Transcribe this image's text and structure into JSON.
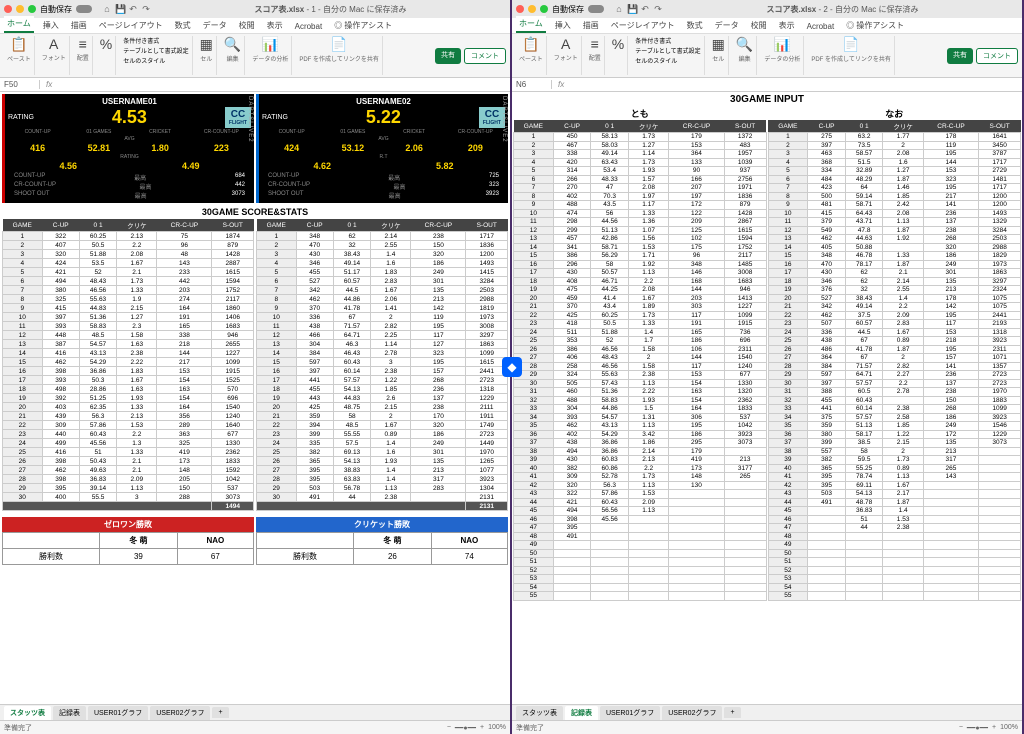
{
  "titlebar": {
    "autosave": "自動保存",
    "filename": "スコア表.xlsx",
    "win1_suffix": "- 1 - 自分の Mac に保存済み",
    "win2_suffix": "- 2 - 自分の Mac に保存済み"
  },
  "ribbon_tabs": [
    "ホーム",
    "挿入",
    "描画",
    "ページレイアウト",
    "数式",
    "データ",
    "校閲",
    "表示",
    "Acrobat",
    "◎ 操作アシスト"
  ],
  "ribbon_groups": {
    "paste": "ペースト",
    "font": "フォント",
    "align": "配置",
    "cond": "条件付き書式",
    "tblfmt": "テーブルとして書式設定",
    "cellstyle": "セルのスタイル",
    "cells": "セル",
    "edit": "編集",
    "analyze": "データの分析",
    "pdf": "PDF を作成してリンクを共有"
  },
  "share": "共有",
  "comment": "コメント",
  "cell_ref1": "F50",
  "cell_ref2": "N6",
  "fx": "fx",
  "cards": {
    "u1": {
      "name": "USERNAME01",
      "rating_lbl": "RATING",
      "rating": "4.53",
      "cc": "CC",
      "flight": "FLIGHT",
      "dl": "DARTSLIVE2",
      "hdrs": [
        "COUNT-UP",
        "01 GAMES",
        "CRICKET",
        "CR-COUNT-UP"
      ],
      "avg_lbl": "AVG",
      "avg": [
        "416",
        "52.81",
        "1.80",
        "223"
      ],
      "rat_lbl": "RATING",
      "rat": [
        "4.56",
        "4.49"
      ],
      "sub": [
        [
          "COUNT-UP",
          "最高",
          "684"
        ],
        [
          "CR-COUNT-UP",
          "最高",
          "442"
        ],
        [
          "SHOOT OUT",
          "最高",
          "3073"
        ]
      ]
    },
    "u2": {
      "name": "USERNAME02",
      "rating_lbl": "RATING",
      "rating": "5.22",
      "cc": "CC",
      "flight": "FLIGHT",
      "dl": "DARTSLIVE2",
      "hdrs": [
        "COUNT-UP",
        "01 GAMES",
        "CRICKET",
        "CR-COUNT-UP"
      ],
      "avg_lbl": "AVG",
      "avg": [
        "424",
        "53.12",
        "2.06",
        "209"
      ],
      "rat_lbl": "R.T",
      "rat": [
        "4.62",
        "5.82"
      ],
      "sub": [
        [
          "COUNT-UP",
          "最高",
          "725"
        ],
        [
          "CR-COUNT-UP",
          "最高",
          "323"
        ],
        [
          "SHOOT OUT",
          "最高",
          "3923"
        ]
      ]
    }
  },
  "score_title": "30GAME SCORE&STATS",
  "score_hdr": [
    "GAME",
    "C-UP",
    "0 1",
    "クリケ",
    "CR-C-UP",
    "S-OUT"
  ],
  "score1": [
    [
      1,
      322,
      "60.25",
      "2.13",
      75,
      1874
    ],
    [
      2,
      407,
      "50.5",
      "2.2",
      96,
      879
    ],
    [
      3,
      320,
      "51.88",
      "2.08",
      48,
      1428
    ],
    [
      4,
      424,
      "53.5",
      "1.67",
      143,
      2887
    ],
    [
      5,
      421,
      52,
      "2.1",
      233,
      1615
    ],
    [
      6,
      494,
      "48.43",
      "1.73",
      442,
      1594
    ],
    [
      7,
      380,
      "46.56",
      "1.33",
      203,
      1752
    ],
    [
      8,
      325,
      "55.63",
      "1.9",
      274,
      2117
    ],
    [
      9,
      415,
      "44.83",
      "2.15",
      164,
      1860
    ],
    [
      10,
      397,
      "51.36",
      "1.27",
      191,
      1406
    ],
    [
      11,
      393,
      "58.83",
      "2.3",
      165,
      1683
    ],
    [
      12,
      448,
      "48.5",
      "1.58",
      338,
      946
    ],
    [
      13,
      387,
      "54.57",
      "1.63",
      218,
      2655
    ],
    [
      14,
      416,
      "43.13",
      "2.38",
      144,
      1227
    ],
    [
      15,
      462,
      "54.29",
      "2.22",
      217,
      1099
    ],
    [
      16,
      398,
      "36.86",
      "1.83",
      153,
      1915
    ],
    [
      17,
      393,
      "50.3",
      "1.67",
      154,
      1525
    ],
    [
      18,
      498,
      "28.86",
      "1.63",
      163,
      570
    ],
    [
      19,
      392,
      "51.25",
      "1.93",
      154,
      696
    ],
    [
      20,
      403,
      "62.35",
      "1.33",
      164,
      1540
    ],
    [
      21,
      439,
      "56.3",
      "2.13",
      356,
      1240
    ],
    [
      22,
      309,
      "57.86",
      "1.53",
      289,
      1640
    ],
    [
      23,
      440,
      "60.43",
      "2.2",
      363,
      677
    ],
    [
      24,
      499,
      "45.56",
      "1.3",
      325,
      1330
    ],
    [
      25,
      416,
      51,
      "1.33",
      419,
      2362
    ],
    [
      26,
      398,
      "50.43",
      "2.1",
      173,
      1833
    ],
    [
      27,
      462,
      "49.63",
      "2.1",
      148,
      1592
    ],
    [
      28,
      398,
      "36.83",
      "2.09",
      205,
      1042
    ],
    [
      29,
      395,
      "39.14",
      "1.13",
      150,
      537
    ],
    [
      30,
      400,
      "55.5",
      3,
      288,
      3073
    ]
  ],
  "score1_total": 1494,
  "score2": [
    [
      1,
      348,
      62,
      "2.14",
      238,
      1717
    ],
    [
      2,
      470,
      32,
      "2.55",
      150,
      1836
    ],
    [
      3,
      430,
      "38.43",
      "1.4",
      320,
      1200
    ],
    [
      4,
      346,
      "49.14",
      "1.6",
      186,
      1493
    ],
    [
      5,
      455,
      "51.17",
      "1.83",
      249,
      1415
    ],
    [
      6,
      527,
      "60.57",
      "2.83",
      301,
      3284
    ],
    [
      7,
      342,
      "44.5",
      "1.67",
      135,
      2503
    ],
    [
      8,
      462,
      "44.86",
      "2.06",
      213,
      2988
    ],
    [
      9,
      370,
      "41.78",
      "1.41",
      142,
      1819
    ],
    [
      10,
      336,
      67,
      2,
      119,
      1973
    ],
    [
      11,
      438,
      "71.57",
      "2.82",
      195,
      3008
    ],
    [
      12,
      466,
      "64.71",
      "2.25",
      117,
      3297
    ],
    [
      13,
      304,
      "46.3",
      "1.14",
      127,
      1863
    ],
    [
      14,
      384,
      "46.43",
      "2.78",
      323,
      1099
    ],
    [
      15,
      597,
      "60.43",
      3,
      195,
      1615
    ],
    [
      16,
      397,
      "60.14",
      "2.38",
      157,
      2441
    ],
    [
      17,
      441,
      "57.57",
      "1.22",
      268,
      2723
    ],
    [
      18,
      455,
      "54.13",
      "1.85",
      236,
      1318
    ],
    [
      19,
      443,
      "44.83",
      "2.6",
      137,
      1229
    ],
    [
      20,
      425,
      "48.75",
      "2.15",
      238,
      2111
    ],
    [
      21,
      359,
      58,
      2,
      170,
      1911
    ],
    [
      22,
      394,
      "48.5",
      "1.67",
      320,
      1749
    ],
    [
      23,
      399,
      "55.55",
      "0.89",
      186,
      2723
    ],
    [
      24,
      335,
      "57.5",
      "1.4",
      249,
      1449
    ],
    [
      25,
      382,
      "69.13",
      "1.6",
      301,
      1970
    ],
    [
      26,
      365,
      "54.13",
      "1.93",
      135,
      1265
    ],
    [
      27,
      395,
      "38.83",
      "1.4",
      213,
      1077
    ],
    [
      28,
      395,
      "63.83",
      "1.4",
      317,
      3923
    ],
    [
      29,
      503,
      "56.78",
      "1.13",
      283,
      1304
    ],
    [
      30,
      491,
      44,
      "2.38",
      "",
      2131
    ]
  ],
  "score2_total": 2131,
  "wins": {
    "zero": "ゼロワン勝敗",
    "cricket": "クリケット勝敗",
    "fuyu": "冬 萌",
    "nao": "NAO",
    "wlbl": "勝利数",
    "z1": 39,
    "z2": 67,
    "c1": 26,
    "c2": 74
  },
  "input_title": "30GAME INPUT",
  "players": {
    "p1": "とも",
    "p2": "なお"
  },
  "input_hdr": [
    "GAME",
    "C-UP",
    "0 1",
    "クリケ",
    "CR-C-UP",
    "S-OUT"
  ],
  "input1": [
    [
      1,
      450,
      "58.13",
      "1.73",
      179,
      1372
    ],
    [
      2,
      467,
      "58.03",
      "1.27",
      153,
      483
    ],
    [
      3,
      338,
      "49.14",
      "1.14",
      364,
      1957
    ],
    [
      4,
      420,
      "63.43",
      "1.73",
      133,
      1039
    ],
    [
      5,
      314,
      "53.4",
      "1.93",
      90,
      937
    ],
    [
      6,
      266,
      "48.33",
      "1.57",
      166,
      2756
    ],
    [
      7,
      270,
      47,
      "2.08",
      207,
      1971
    ],
    [
      8,
      402,
      "70.3",
      "1.97",
      197,
      1836
    ],
    [
      9,
      488,
      "43.5",
      "1.17",
      172,
      879
    ],
    [
      10,
      474,
      56,
      "1.33",
      122,
      1428
    ],
    [
      11,
      298,
      "44.56",
      "1.36",
      209,
      2867
    ],
    [
      12,
      299,
      "51.13",
      "1.07",
      125,
      1615
    ],
    [
      13,
      457,
      "42.86",
      "1.56",
      102,
      1594
    ],
    [
      14,
      341,
      "58.71",
      "1.53",
      175,
      1752
    ],
    [
      15,
      386,
      "56.29",
      "1.71",
      96,
      2117
    ],
    [
      16,
      296,
      58,
      "1.92",
      348,
      1485
    ],
    [
      17,
      430,
      "50.57",
      "1.13",
      146,
      3008
    ],
    [
      18,
      408,
      "46.71",
      "2.2",
      168,
      1683
    ],
    [
      19,
      475,
      "44.25",
      "2.08",
      144,
      946
    ],
    [
      20,
      459,
      "41.4",
      "1.67",
      203,
      1413
    ],
    [
      21,
      370,
      "43.4",
      "1.89",
      303,
      1227
    ],
    [
      22,
      425,
      "60.25",
      "1.73",
      117,
      1099
    ],
    [
      23,
      418,
      "50.5",
      "1.33",
      191,
      1915
    ],
    [
      24,
      511,
      "51.88",
      "1.4",
      165,
      736
    ],
    [
      25,
      353,
      52,
      "1.7",
      186,
      696
    ],
    [
      26,
      386,
      "46.56",
      "1.58",
      106,
      2311
    ],
    [
      27,
      406,
      "48.43",
      2,
      144,
      1540
    ],
    [
      28,
      258,
      "46.56",
      "1.58",
      117,
      1240
    ],
    [
      29,
      324,
      "55.63",
      "2.38",
      153,
      677
    ],
    [
      30,
      505,
      "57.43",
      "1.13",
      154,
      1330
    ],
    [
      31,
      460,
      "51.36",
      "2.22",
      163,
      1320
    ],
    [
      32,
      488,
      "58.83",
      "1.93",
      154,
      2362
    ],
    [
      33,
      304,
      "44.86",
      "1.5",
      164,
      1833
    ],
    [
      34,
      393,
      "54.57",
      "1.31",
      306,
      537
    ],
    [
      35,
      462,
      "43.13",
      "1.13",
      195,
      1042
    ],
    [
      36,
      402,
      "54.29",
      "3.42",
      186,
      3923
    ],
    [
      37,
      438,
      "36.86",
      "1.86",
      295,
      3073
    ],
    [
      38,
      494,
      "36.86",
      "2.14",
      179,
      ""
    ],
    [
      39,
      430,
      "60.83",
      "2.13",
      419,
      213
    ],
    [
      40,
      382,
      "60.86",
      "2.2",
      173,
      3177
    ],
    [
      41,
      309,
      "52.78",
      "1.73",
      148,
      265
    ],
    [
      42,
      320,
      "56.3",
      "1.13",
      130,
      ""
    ],
    [
      43,
      322,
      "57.86",
      "1.53",
      "",
      ""
    ],
    [
      44,
      421,
      "60.43",
      "2.09",
      "",
      ""
    ],
    [
      45,
      494,
      "56.56",
      "1.13",
      "",
      ""
    ],
    [
      46,
      398,
      "45.56",
      "",
      "",
      ""
    ],
    [
      47,
      395,
      "",
      "",
      "",
      ""
    ],
    [
      48,
      491,
      "",
      "",
      "",
      ""
    ],
    [
      49,
      "",
      "",
      "",
      "",
      ""
    ],
    [
      50,
      "",
      "",
      "",
      "",
      ""
    ],
    [
      51,
      "",
      "",
      "",
      "",
      ""
    ],
    [
      52,
      "",
      "",
      "",
      "",
      ""
    ],
    [
      53,
      "",
      "",
      "",
      "",
      ""
    ],
    [
      54,
      "",
      "",
      "",
      "",
      ""
    ],
    [
      55,
      "",
      "",
      "",
      "",
      ""
    ]
  ],
  "input2": [
    [
      1,
      275,
      "63.2",
      "1.77",
      178,
      1641
    ],
    [
      2,
      397,
      "73.5",
      2,
      119,
      3450
    ],
    [
      3,
      463,
      "58.57",
      "2.08",
      195,
      3787
    ],
    [
      4,
      368,
      "51.5",
      "1.6",
      144,
      1717
    ],
    [
      5,
      334,
      "32.89",
      "1.27",
      153,
      2729
    ],
    [
      6,
      484,
      "48.29",
      "1.87",
      323,
      1481
    ],
    [
      7,
      423,
      64,
      "1.46",
      195,
      1717
    ],
    [
      8,
      500,
      "59.14",
      "1.85",
      217,
      1200
    ],
    [
      9,
      481,
      "58.71",
      "2.42",
      141,
      1200
    ],
    [
      10,
      415,
      "64.43",
      "2.08",
      236,
      1493
    ],
    [
      11,
      379,
      "43.71",
      "1.13",
      137,
      1329
    ],
    [
      12,
      549,
      "47.8",
      "1.87",
      238,
      3284
    ],
    [
      13,
      462,
      "44.63",
      "1.92",
      268,
      2503
    ],
    [
      14,
      405,
      "50.88",
      "",
      320,
      2988
    ],
    [
      15,
      348,
      "46.78",
      "1.33",
      186,
      1829
    ],
    [
      16,
      470,
      "78.17",
      "1.87",
      249,
      1973
    ],
    [
      17,
      430,
      62,
      "2.1",
      301,
      1863
    ],
    [
      18,
      346,
      62,
      "2.14",
      135,
      3297
    ],
    [
      19,
      376,
      32,
      "2.55",
      213,
      2324
    ],
    [
      20,
      527,
      "38.43",
      "1.4",
      178,
      1075
    ],
    [
      21,
      342,
      "49.14",
      "2.2",
      142,
      1075
    ],
    [
      22,
      462,
      "37.5",
      "2.09",
      195,
      2441
    ],
    [
      23,
      507,
      "60.57",
      "2.83",
      117,
      2193
    ],
    [
      24,
      336,
      "44.5",
      "1.67",
      153,
      1318
    ],
    [
      25,
      438,
      67,
      "0.89",
      218,
      3923
    ],
    [
      26,
      486,
      "41.78",
      "1.87",
      195,
      2311
    ],
    [
      27,
      364,
      67,
      2,
      157,
      1071
    ],
    [
      28,
      384,
      "71.57",
      "2.82",
      141,
      1357
    ],
    [
      29,
      597,
      "64.71",
      "2.27",
      236,
      2723
    ],
    [
      30,
      397,
      "57.57",
      "2.2",
      137,
      2723
    ],
    [
      31,
      388,
      "60.5",
      "2.78",
      238,
      1970
    ],
    [
      32,
      455,
      "60.43",
      "",
      150,
      1883
    ],
    [
      33,
      441,
      "60.14",
      "2.38",
      268,
      1099
    ],
    [
      34,
      375,
      "57.57",
      "2.58",
      186,
      3923
    ],
    [
      35,
      359,
      "51.13",
      "1.85",
      249,
      1546
    ],
    [
      36,
      380,
      "58.17",
      "1.22",
      172,
      1229
    ],
    [
      37,
      399,
      "38.5",
      "2.15",
      135,
      3073
    ],
    [
      38,
      557,
      58,
      2,
      213,
      ""
    ],
    [
      39,
      382,
      "59.5",
      "1.73",
      317,
      ""
    ],
    [
      40,
      365,
      "55.25",
      "0.89",
      265,
      ""
    ],
    [
      41,
      395,
      "78.74",
      "1.13",
      143,
      ""
    ],
    [
      42,
      395,
      "69.11",
      "1.67",
      "",
      ""
    ],
    [
      43,
      503,
      "54.13",
      "2.17",
      "",
      ""
    ],
    [
      44,
      491,
      "48.78",
      "1.87",
      "",
      ""
    ],
    [
      45,
      "",
      "36.83",
      "1.4",
      "",
      ""
    ],
    [
      46,
      "",
      "51",
      "1.53",
      "",
      ""
    ],
    [
      47,
      "",
      44,
      "2.38",
      "",
      ""
    ],
    [
      48,
      "",
      "",
      "",
      "",
      ""
    ],
    [
      49,
      "",
      "",
      "",
      "",
      ""
    ],
    [
      50,
      "",
      "",
      "",
      "",
      ""
    ],
    [
      51,
      "",
      "",
      "",
      "",
      ""
    ],
    [
      52,
      "",
      "",
      "",
      "",
      ""
    ],
    [
      53,
      "",
      "",
      "",
      "",
      ""
    ],
    [
      54,
      "",
      "",
      "",
      "",
      ""
    ],
    [
      55,
      "",
      "",
      "",
      "",
      ""
    ]
  ],
  "sheets": [
    "スタッツ表",
    "記録表",
    "USER01グラフ",
    "USER02グラフ"
  ],
  "status": "準備完了",
  "zoom": "100%"
}
